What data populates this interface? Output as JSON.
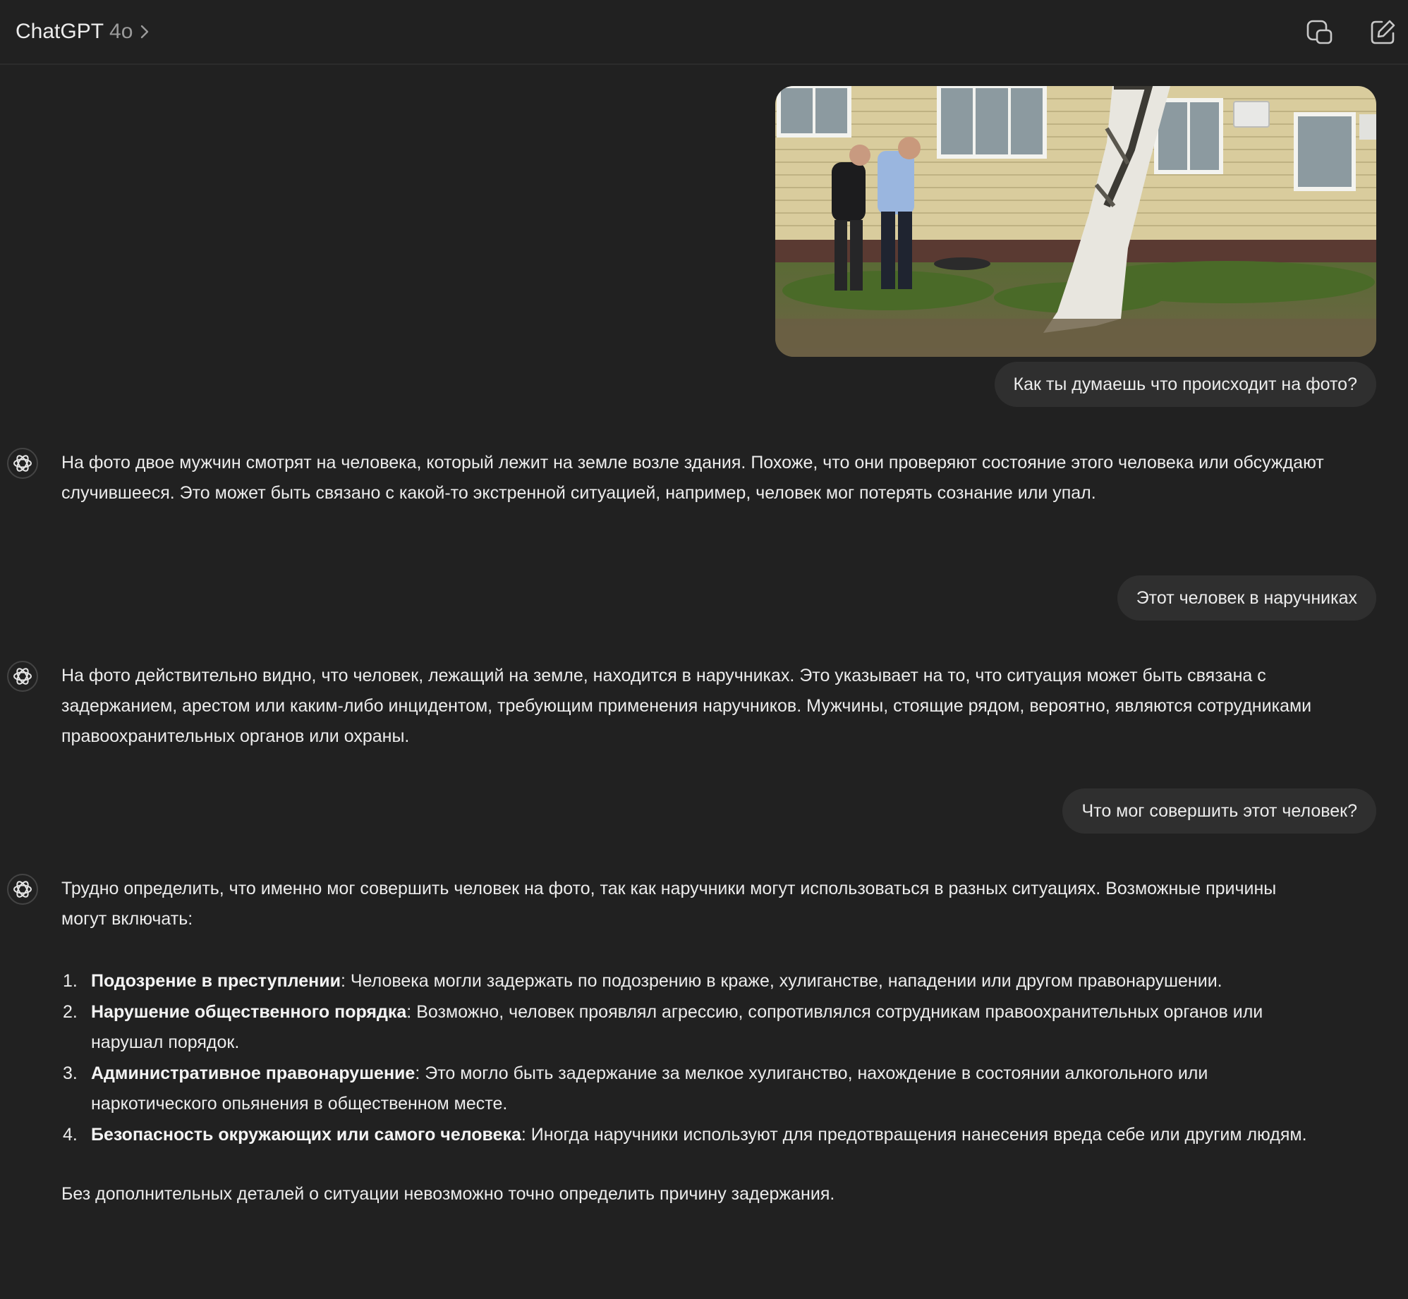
{
  "header": {
    "app_name": "ChatGPT",
    "model": "4o",
    "icons": [
      "chevron-right-icon",
      "share-icon",
      "new-chat-icon"
    ]
  },
  "conversation": {
    "user_messages": [
      "Как ты думаешь что происходит на фото?",
      "Этот человек в наручниках",
      "Что мог совершить этот человек?"
    ],
    "assistant_messages": [
      {
        "text": "На фото двое мужчин смотрят на человека, который лежит на земле возле здания. Похоже, что они проверяют состояние этого человека или обсуждают случившееся. Это может быть связано с какой-то экстренной ситуацией, например, человек мог потерять сознание или упал."
      },
      {
        "text": "На фото действительно видно, что человек, лежащий на земле, находится в наручниках. Это указывает на то, что ситуация может быть связана с задержанием, арестом или каким-либо инцидентом, требующим применения наручников. Мужчины, стоящие рядом, вероятно, являются сотрудниками правоохранительных органов или охраны."
      },
      {
        "intro": "Трудно определить, что именно мог совершить человек на фото, так как наручники могут использоваться в разных ситуациях. Возможные причины могут включать:",
        "items": [
          {
            "num": "1.",
            "title": "Подозрение в преступлении",
            "text": ": Человека могли задержать по подозрению в краже, хулиганстве, нападении или другом правонарушении."
          },
          {
            "num": "2.",
            "title": "Нарушение общественного порядка",
            "text": ": Возможно, человек проявлял агрессию, сопротивлялся сотрудникам правоохранительных органов или нарушал порядок."
          },
          {
            "num": "3.",
            "title": "Административное правонарушение",
            "text": ": Это могло быть задержание за мелкое хулиганство, нахождение в состоянии алкогольного или наркотического опьянения в общественном месте."
          },
          {
            "num": "4.",
            "title": "Безопасность окружающих или самого человека",
            "text": ": Иногда наручники используют для предотвращения нанесения вреда себе или другим людям."
          }
        ],
        "outro": "Без дополнительных деталей о ситуации невозможно точно определить причину задержания."
      }
    ]
  },
  "colors": {
    "background": "#212121",
    "bubble": "#2f2f2f",
    "text": "#ececec",
    "muted": "#9b9b9b"
  }
}
